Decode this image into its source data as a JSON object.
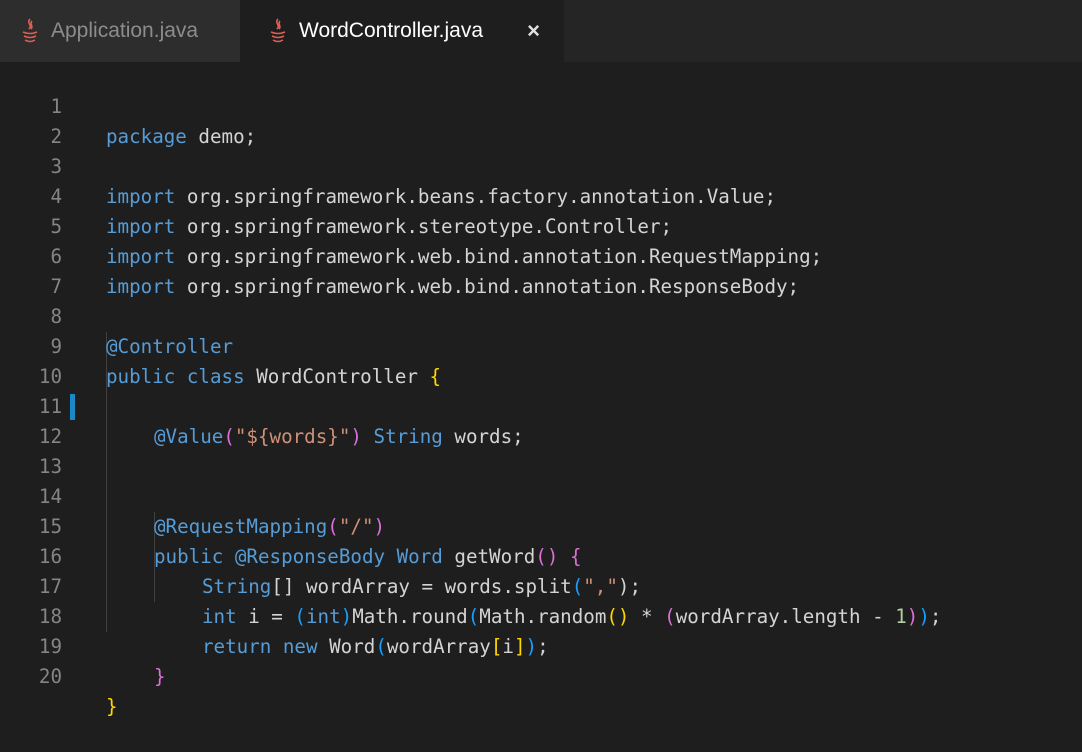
{
  "tabs": [
    {
      "label": "Application.java",
      "active": false,
      "icon": "java-icon"
    },
    {
      "label": "WordController.java",
      "active": true,
      "icon": "java-icon",
      "close": "×"
    }
  ],
  "line_numbers": [
    "1",
    "2",
    "3",
    "4",
    "5",
    "6",
    "7",
    "8",
    "9",
    "10",
    "11",
    "12",
    "13",
    "14",
    "15",
    "16",
    "17",
    "18",
    "19",
    "20"
  ],
  "code": {
    "l1": [
      "package",
      " demo;"
    ],
    "l3": [
      "import",
      " org.springframework.beans.factory.annotation.Value;"
    ],
    "l4": [
      "import",
      " org.springframework.stereotype.Controller;"
    ],
    "l5": [
      "import",
      " org.springframework.web.bind.annotation.RequestMapping;"
    ],
    "l6": [
      "import",
      " org.springframework.web.bind.annotation.ResponseBody;"
    ],
    "l8": [
      "@Controller"
    ],
    "l9": [
      "public",
      " ",
      "class",
      " WordController ",
      "{"
    ],
    "l11": [
      "@Value",
      "(",
      "\"${words}\"",
      ")",
      " ",
      "String",
      " words;"
    ],
    "l14": [
      "@RequestMapping",
      "(",
      "\"/\"",
      ")"
    ],
    "l15": [
      "public",
      " ",
      "@ResponseBody",
      " ",
      "Word",
      " ",
      "getWord",
      "()",
      " ",
      "{"
    ],
    "l16": [
      "String",
      "[]",
      " wordArray = words.",
      "split",
      "(",
      "\",\"",
      ");"
    ],
    "l17": [
      "int",
      " i = ",
      "(",
      "int",
      ")",
      "Math.",
      "round",
      "(",
      "Math.",
      "random",
      "()",
      " * ",
      "(",
      "wordArray.length - ",
      "1",
      ")",
      ")",
      ";"
    ],
    "l18": [
      "return",
      " ",
      "new",
      " ",
      "Word",
      "(",
      "wordArray",
      "[",
      "i",
      "]",
      ")",
      ";"
    ],
    "l19": [
      "}"
    ],
    "l20": [
      "}"
    ]
  },
  "colors": {
    "background": "#1e1e1e",
    "tabbar": "#252526",
    "keyword": "#569cd6",
    "string": "#ce9178",
    "bracket_gold": "#ffd700",
    "bracket_orchid": "#da70d6",
    "bracket_blue": "#179fff",
    "caret_mark": "#1b88c7"
  }
}
